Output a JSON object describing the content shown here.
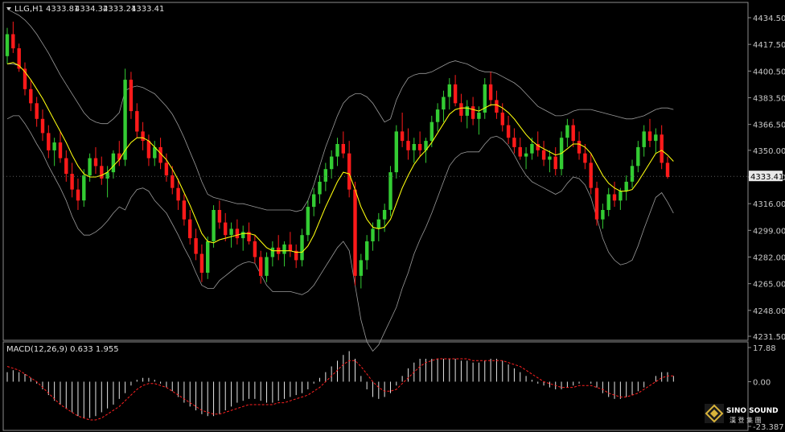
{
  "chart_data": {
    "type": "candlestick",
    "price_header": {
      "symbol": "LLG,H1",
      "ohlc": [
        "4333.81",
        "4334.32",
        "4333.21",
        "4333.41"
      ]
    },
    "price_axis": {
      "ticks": [
        "4434.50",
        "4417.50",
        "4400.50",
        "4383.50",
        "4366.50",
        "4350.00",
        "4333.00",
        "4316.00",
        "4299.00",
        "4282.00",
        "4265.00",
        "4248.00",
        "4231.50"
      ],
      "ylim": [
        4231.5,
        4434.5
      ],
      "current_price": "4333.41"
    },
    "macd": {
      "label": "MACD(12,26,9) 0.633 1.955",
      "ticks": [
        "17.88",
        "0.00",
        "-23.387"
      ],
      "ylim": [
        -23.387,
        17.88
      ]
    },
    "candles": [
      [
        4410,
        4428,
        4405,
        4424
      ],
      [
        4424,
        4432,
        4412,
        4415
      ],
      [
        4415,
        4418,
        4400,
        4402
      ],
      [
        4402,
        4406,
        4385,
        4389
      ],
      [
        4389,
        4395,
        4375,
        4380
      ],
      [
        4380,
        4384,
        4365,
        4370
      ],
      [
        4370,
        4376,
        4356,
        4361
      ],
      [
        4361,
        4366,
        4345,
        4350
      ],
      [
        4350,
        4358,
        4340,
        4355
      ],
      [
        4355,
        4362,
        4342,
        4345
      ],
      [
        4345,
        4350,
        4330,
        4335
      ],
      [
        4335,
        4342,
        4320,
        4325
      ],
      [
        4325,
        4332,
        4312,
        4318
      ],
      [
        4318,
        4338,
        4314,
        4334
      ],
      [
        4334,
        4348,
        4330,
        4345
      ],
      [
        4345,
        4352,
        4335,
        4340
      ],
      [
        4340,
        4346,
        4328,
        4332
      ],
      [
        4332,
        4340,
        4320,
        4336
      ],
      [
        4336,
        4350,
        4332,
        4348
      ],
      [
        4348,
        4356,
        4340,
        4344
      ],
      [
        4344,
        4402,
        4340,
        4395
      ],
      [
        4395,
        4400,
        4370,
        4375
      ],
      [
        4375,
        4380,
        4358,
        4362
      ],
      [
        4362,
        4368,
        4350,
        4356
      ],
      [
        4356,
        4360,
        4340,
        4345
      ],
      [
        4345,
        4356,
        4340,
        4352
      ],
      [
        4352,
        4358,
        4338,
        4342
      ],
      [
        4342,
        4348,
        4330,
        4334
      ],
      [
        4334,
        4340,
        4322,
        4326
      ],
      [
        4326,
        4332,
        4312,
        4318
      ],
      [
        4318,
        4322,
        4302,
        4306
      ],
      [
        4306,
        4312,
        4290,
        4294
      ],
      [
        4294,
        4300,
        4280,
        4284
      ],
      [
        4284,
        4290,
        4266,
        4272
      ],
      [
        4272,
        4295,
        4268,
        4292
      ],
      [
        4292,
        4315,
        4288,
        4312
      ],
      [
        4312,
        4318,
        4300,
        4304
      ],
      [
        4304,
        4310,
        4292,
        4296
      ],
      [
        4296,
        4304,
        4288,
        4300
      ],
      [
        4300,
        4306,
        4290,
        4294
      ],
      [
        4294,
        4302,
        4286,
        4298
      ],
      [
        4298,
        4304,
        4290,
        4292
      ],
      [
        4292,
        4296,
        4278,
        4282
      ],
      [
        4282,
        4286,
        4265,
        4270
      ],
      [
        4270,
        4285,
        4266,
        4282
      ],
      [
        4282,
        4292,
        4276,
        4288
      ],
      [
        4288,
        4296,
        4280,
        4284
      ],
      [
        4284,
        4292,
        4276,
        4290
      ],
      [
        4290,
        4298,
        4282,
        4286
      ],
      [
        4286,
        4290,
        4275,
        4280
      ],
      [
        4280,
        4300,
        4276,
        4296
      ],
      [
        4296,
        4318,
        4292,
        4314
      ],
      [
        4314,
        4326,
        4308,
        4322
      ],
      [
        4322,
        4334,
        4316,
        4330
      ],
      [
        4330,
        4342,
        4324,
        4338
      ],
      [
        4338,
        4350,
        4332,
        4346
      ],
      [
        4346,
        4358,
        4340,
        4354
      ],
      [
        4354,
        4362,
        4345,
        4348
      ],
      [
        4348,
        4356,
        4320,
        4325
      ],
      [
        4325,
        4330,
        4264,
        4270
      ],
      [
        4270,
        4284,
        4262,
        4280
      ],
      [
        4280,
        4296,
        4274,
        4292
      ],
      [
        4292,
        4304,
        4286,
        4300
      ],
      [
        4300,
        4310,
        4292,
        4306
      ],
      [
        4306,
        4316,
        4298,
        4312
      ],
      [
        4312,
        4340,
        4308,
        4336
      ],
      [
        4336,
        4366,
        4332,
        4362
      ],
      [
        4362,
        4374,
        4352,
        4356
      ],
      [
        4356,
        4364,
        4344,
        4350
      ],
      [
        4350,
        4358,
        4342,
        4354
      ],
      [
        4354,
        4362,
        4346,
        4350
      ],
      [
        4350,
        4358,
        4342,
        4356
      ],
      [
        4356,
        4372,
        4352,
        4368
      ],
      [
        4368,
        4380,
        4362,
        4376
      ],
      [
        4376,
        4388,
        4368,
        4384
      ],
      [
        4384,
        4396,
        4376,
        4392
      ],
      [
        4392,
        4398,
        4378,
        4380
      ],
      [
        4380,
        4386,
        4368,
        4372
      ],
      [
        4372,
        4382,
        4364,
        4378
      ],
      [
        4378,
        4384,
        4366,
        4370
      ],
      [
        4370,
        4378,
        4360,
        4374
      ],
      [
        4374,
        4396,
        4370,
        4392
      ],
      [
        4392,
        4400,
        4378,
        4382
      ],
      [
        4382,
        4388,
        4370,
        4374
      ],
      [
        4374,
        4380,
        4362,
        4366
      ],
      [
        4366,
        4372,
        4354,
        4358
      ],
      [
        4358,
        4364,
        4348,
        4352
      ],
      [
        4352,
        4358,
        4344,
        4346
      ],
      [
        4346,
        4352,
        4338,
        4348
      ],
      [
        4348,
        4358,
        4344,
        4354
      ],
      [
        4354,
        4362,
        4346,
        4350
      ],
      [
        4350,
        4356,
        4340,
        4344
      ],
      [
        4344,
        4350,
        4336,
        4346
      ],
      [
        4346,
        4352,
        4334,
        4338
      ],
      [
        4338,
        4362,
        4334,
        4358
      ],
      [
        4358,
        4370,
        4352,
        4366
      ],
      [
        4366,
        4370,
        4352,
        4356
      ],
      [
        4356,
        4362,
        4344,
        4348
      ],
      [
        4348,
        4354,
        4338,
        4342
      ],
      [
        4342,
        4348,
        4322,
        4326
      ],
      [
        4326,
        4330,
        4302,
        4306
      ],
      [
        4306,
        4316,
        4300,
        4312
      ],
      [
        4312,
        4326,
        4308,
        4322
      ],
      [
        4322,
        4330,
        4314,
        4318
      ],
      [
        4318,
        4326,
        4312,
        4324
      ],
      [
        4324,
        4334,
        4318,
        4330
      ],
      [
        4330,
        4344,
        4326,
        4340
      ],
      [
        4340,
        4356,
        4336,
        4352
      ],
      [
        4352,
        4366,
        4346,
        4362
      ],
      [
        4362,
        4370,
        4352,
        4356
      ],
      [
        4356,
        4364,
        4348,
        4360
      ],
      [
        4360,
        4366,
        4338,
        4342
      ],
      [
        4342,
        4346,
        4332,
        4333
      ]
    ],
    "series": [
      {
        "name": "MA",
        "color": "#ffff00",
        "values": [
          4405,
          4406,
          4404,
          4400,
          4395,
          4389,
          4383,
          4376,
          4369,
          4362,
          4355,
          4347,
          4340,
          4335,
          4333,
          4333,
          4334,
          4336,
          4340,
          4344,
          4350,
          4355,
          4358,
          4358,
          4356,
          4352,
          4348,
          4344,
          4338,
          4331,
          4323,
          4315,
          4306,
          4297,
          4292,
          4291,
          4293,
          4294,
          4295,
          4296,
          4297,
          4297,
          4296,
          4292,
          4288,
          4286,
          4286,
          4286,
          4286,
          4285,
          4285,
          4289,
          4296,
          4305,
          4314,
          4322,
          4330,
          4336,
          4335,
          4325,
          4314,
          4306,
          4301,
          4300,
          4301,
          4306,
          4316,
          4326,
          4334,
          4341,
          4346,
          4350,
          4355,
          4361,
          4367,
          4373,
          4376,
          4377,
          4377,
          4376,
          4375,
          4377,
          4379,
          4379,
          4377,
          4374,
          4370,
          4365,
          4360,
          4356,
          4353,
          4351,
          4349,
          4347,
          4348,
          4351,
          4354,
          4354,
          4352,
          4348,
          4341,
          4334,
          4329,
          4326,
          4324,
          4324,
          4325,
          4330,
          4336,
          4342,
          4348,
          4350,
          4347,
          4343
        ]
      },
      {
        "name": "BB-upper",
        "color": "#9a9a9a",
        "values": [
          4440,
          4438,
          4436,
          4433,
          4429,
          4424,
          4418,
          4412,
          4405,
          4398,
          4392,
          4386,
          4380,
          4374,
          4370,
          4368,
          4367,
          4367,
          4370,
          4374,
          4388,
          4390,
          4391,
          4390,
          4388,
          4386,
          4382,
          4378,
          4373,
          4366,
          4358,
          4349,
          4340,
          4330,
          4322,
          4320,
          4319,
          4318,
          4317,
          4316,
          4316,
          4315,
          4314,
          4313,
          4312,
          4312,
          4312,
          4312,
          4312,
          4311,
          4312,
          4318,
          4328,
          4340,
          4352,
          4362,
          4372,
          4380,
          4384,
          4386,
          4386,
          4384,
          4380,
          4374,
          4368,
          4370,
          4382,
          4390,
          4396,
          4398,
          4399,
          4399,
          4400,
          4402,
          4404,
          4406,
          4407,
          4406,
          4405,
          4403,
          4401,
          4400,
          4400,
          4399,
          4397,
          4395,
          4393,
          4390,
          4386,
          4382,
          4378,
          4376,
          4374,
          4372,
          4372,
          4373,
          4375,
          4376,
          4376,
          4376,
          4375,
          4374,
          4373,
          4372,
          4371,
          4370,
          4370,
          4371,
          4372,
          4374,
          4376,
          4377,
          4377,
          4376
        ]
      },
      {
        "name": "BB-lower",
        "color": "#9a9a9a",
        "values": [
          4370,
          4372,
          4372,
          4367,
          4361,
          4354,
          4348,
          4340,
          4333,
          4326,
          4318,
          4308,
          4300,
          4296,
          4296,
          4298,
          4301,
          4305,
          4310,
          4314,
          4312,
          4320,
          4325,
          4326,
          4324,
          4318,
          4314,
          4310,
          4303,
          4296,
          4288,
          4281,
          4272,
          4264,
          4262,
          4262,
          4267,
          4270,
          4273,
          4276,
          4278,
          4279,
          4278,
          4271,
          4264,
          4260,
          4260,
          4260,
          4260,
          4259,
          4258,
          4260,
          4264,
          4270,
          4276,
          4282,
          4288,
          4292,
          4286,
          4264,
          4242,
          4228,
          4222,
          4226,
          4234,
          4242,
          4250,
          4262,
          4272,
          4284,
          4293,
          4301,
          4310,
          4320,
          4330,
          4340,
          4345,
          4348,
          4349,
          4349,
          4349,
          4354,
          4358,
          4359,
          4357,
          4353,
          4347,
          4340,
          4334,
          4330,
          4328,
          4326,
          4324,
          4322,
          4324,
          4329,
          4333,
          4332,
          4328,
          4320,
          4307,
          4294,
          4285,
          4280,
          4277,
          4278,
          4280,
          4289,
          4300,
          4310,
          4320,
          4323,
          4317,
          4310
        ]
      },
      {
        "name": "BB-mid",
        "color": "#b0b0b0",
        "values": [
          4405,
          4405,
          4404,
          4400,
          4395,
          4389,
          4383,
          4376,
          4369,
          4362,
          4355,
          4347,
          4340,
          4335,
          4333,
          4333,
          4334,
          4336,
          4340,
          4344,
          4350,
          4355,
          4358,
          4358,
          4356,
          4352,
          4348,
          4344,
          4338,
          4331,
          4323,
          4315,
          4306,
          4297,
          4292,
          4291,
          4293,
          4294,
          4295,
          4296,
          4297,
          4297,
          4296,
          4292,
          4288,
          4286,
          4286,
          4286,
          4286,
          4285,
          4285,
          4289,
          4296,
          4305,
          4314,
          4322,
          4330,
          4336,
          4335,
          4325,
          4314,
          4306,
          4301,
          4300,
          4301,
          4306,
          4316,
          4326,
          4334,
          4341,
          4346,
          4350,
          4355,
          4361,
          4367,
          4373,
          4376,
          4377,
          4377,
          4376,
          4375,
          4377,
          4379,
          4379,
          4377,
          4374,
          4370,
          4365,
          4360,
          4356,
          4353,
          4351,
          4349,
          4347,
          4348,
          4351,
          4354,
          4354,
          4352,
          4348,
          4341,
          4334,
          4329,
          4326,
          4324,
          4324,
          4325,
          4330,
          4336,
          4342,
          4348,
          4350,
          4347,
          4343
        ]
      }
    ],
    "macd_hist": [
      5,
      6,
      5,
      4,
      2,
      -1,
      -4,
      -7,
      -10,
      -12,
      -14,
      -16,
      -18,
      -19,
      -19,
      -18,
      -16,
      -14,
      -12,
      -9,
      -6,
      -2,
      1,
      2,
      2,
      1,
      -1,
      -3,
      -5,
      -8,
      -11,
      -13,
      -15,
      -17,
      -18,
      -18,
      -17,
      -15,
      -13,
      -11,
      -10,
      -9,
      -9,
      -10,
      -11,
      -11,
      -10,
      -9,
      -8,
      -7,
      -6,
      -4,
      -1,
      2,
      5,
      8,
      11,
      14,
      16,
      12,
      3,
      -4,
      -8,
      -9,
      -8,
      -6,
      -2,
      3,
      7,
      10,
      12,
      12,
      12,
      12,
      12,
      12,
      12,
      11,
      11,
      10,
      10,
      11,
      12,
      12,
      11,
      9,
      7,
      5,
      3,
      1,
      -1,
      -2,
      -3,
      -4,
      -4,
      -3,
      -2,
      -1,
      0,
      -1,
      -3,
      -6,
      -8,
      -9,
      -9,
      -8,
      -7,
      -5,
      -3,
      0,
      3,
      5,
      5,
      3
    ],
    "macd_signal": [
      8,
      7,
      6,
      4,
      2,
      0,
      -3,
      -6,
      -9,
      -12,
      -14,
      -16,
      -18,
      -19,
      -20,
      -20,
      -19,
      -17,
      -15,
      -13,
      -10,
      -7,
      -4,
      -2,
      -1,
      -1,
      -2,
      -3,
      -5,
      -7,
      -9,
      -11,
      -13,
      -15,
      -16,
      -17,
      -17,
      -16,
      -15,
      -14,
      -13,
      -12,
      -12,
      -12,
      -12,
      -12,
      -11,
      -11,
      -10,
      -9,
      -8,
      -7,
      -5,
      -3,
      0,
      3,
      6,
      9,
      11,
      11,
      8,
      4,
      0,
      -3,
      -5,
      -5,
      -4,
      -1,
      2,
      5,
      8,
      10,
      11,
      12,
      12,
      12,
      12,
      12,
      12,
      11,
      11,
      11,
      11,
      11,
      11,
      10,
      9,
      8,
      6,
      4,
      2,
      0,
      -1,
      -2,
      -3,
      -3,
      -3,
      -2,
      -2,
      -2,
      -3,
      -4,
      -6,
      -7,
      -8,
      -8,
      -7,
      -6,
      -4,
      -2,
      0,
      2,
      3,
      3
    ]
  },
  "logo": {
    "name": "SINO SOUND",
    "subtitle": "漢 登 集 團"
  }
}
